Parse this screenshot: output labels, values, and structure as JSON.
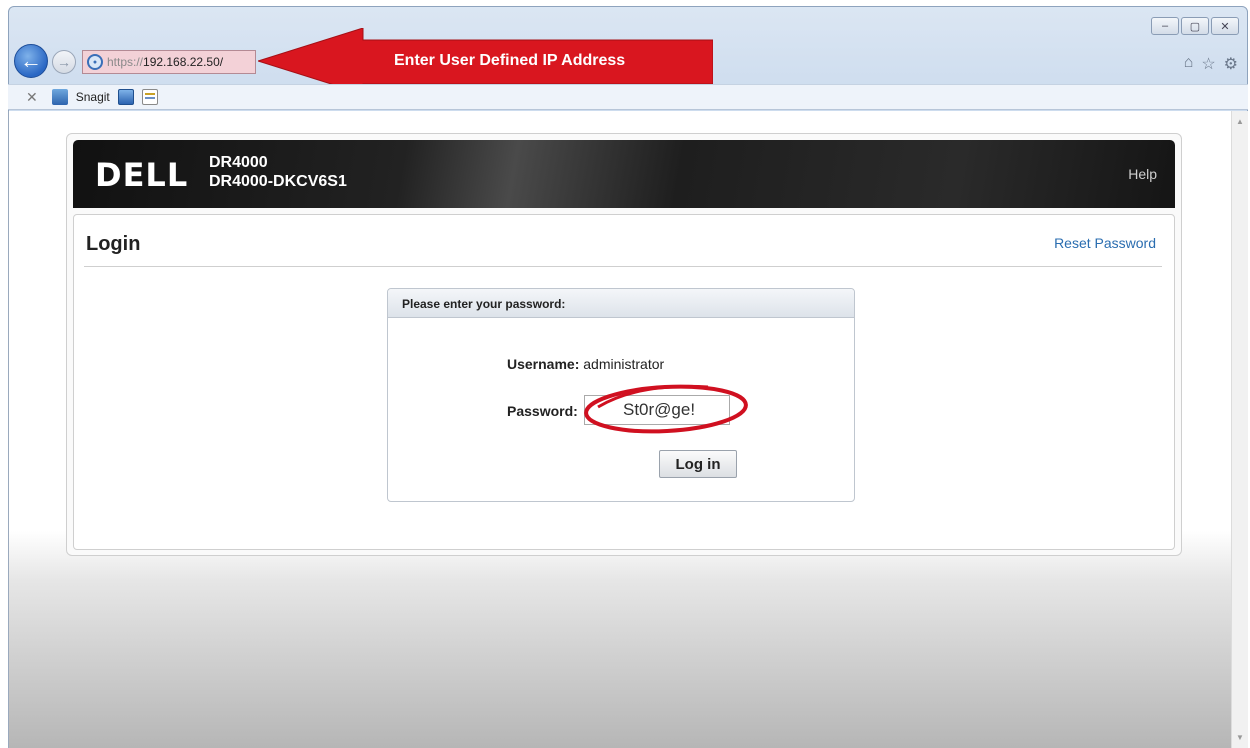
{
  "browser": {
    "url_scheme": "https://",
    "url_host": "192.168.22.50/",
    "annotation_text": "Enter User Defined IP Address",
    "favorites": [
      {
        "label": "Snagit",
        "icon": "snagit-icon"
      },
      {
        "label": "",
        "icon": "blue-app-icon"
      },
      {
        "label": "",
        "icon": "document-icon"
      }
    ],
    "window_buttons": {
      "minimize": "–",
      "maximize": "▢",
      "close": "✕"
    },
    "toolbar_icons": [
      "home-icon",
      "star-icon",
      "gear-icon"
    ],
    "colors": {
      "annotation": "#d9161f",
      "address_highlight": "#f3d1d7"
    }
  },
  "app": {
    "brand": "D€LL",
    "product": "DR4000",
    "device": "DR4000-DKCV6S1",
    "help": "Help",
    "page_title": "Login",
    "reset_password": "Reset Password",
    "login_box": {
      "header": "Please enter your password:",
      "username_label": "Username:",
      "username_value": "administrator",
      "password_label": "Password:",
      "password_value": "St0r@ge!",
      "submit": "Log in"
    }
  }
}
